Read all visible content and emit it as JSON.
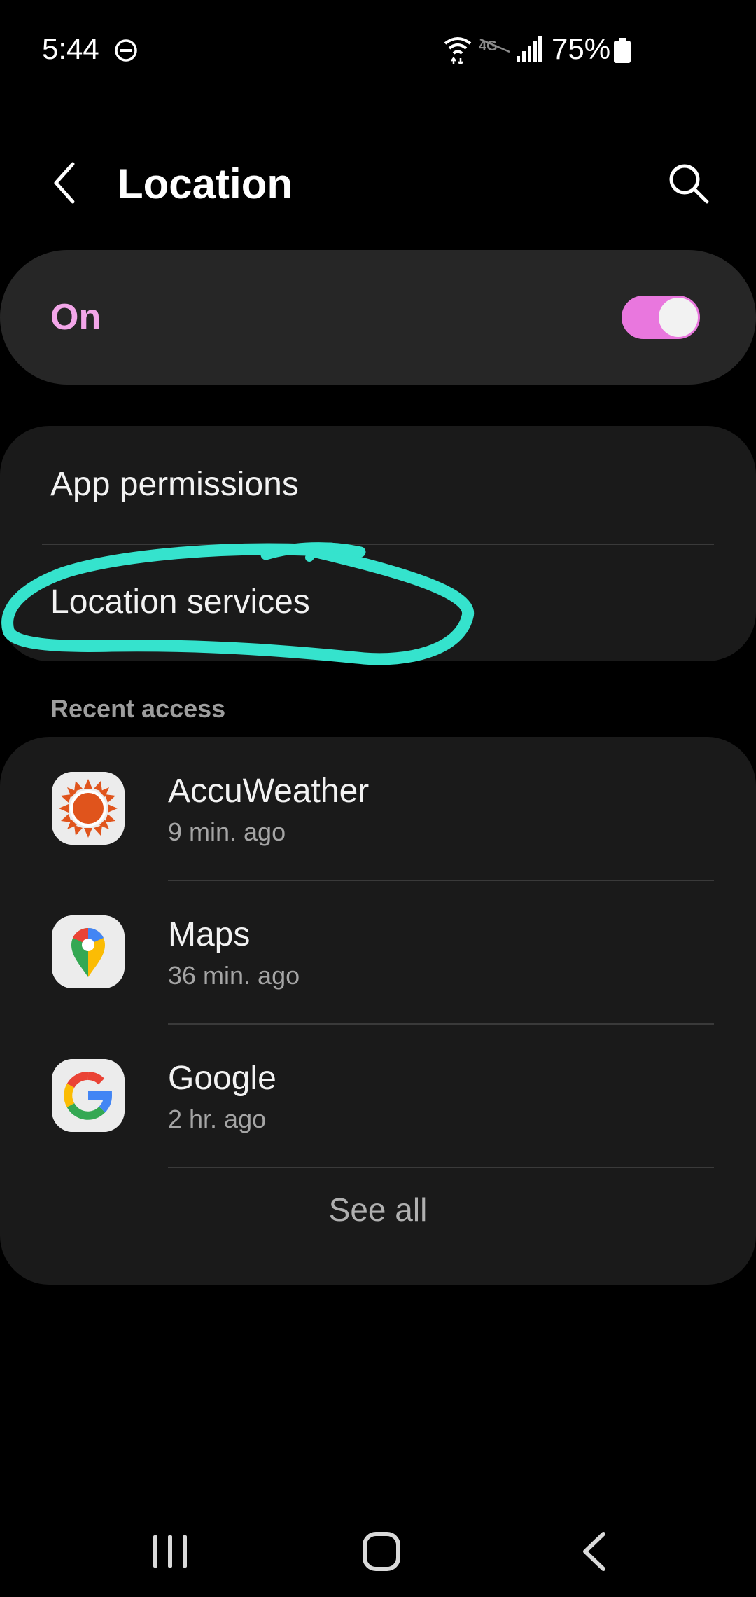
{
  "status_bar": {
    "time": "5:44",
    "battery_percent": "75%",
    "icons": [
      "do-not-disturb-icon",
      "wifi-icon",
      "4g-icon",
      "signal-icon",
      "battery-icon"
    ]
  },
  "header": {
    "title": "Location",
    "back_icon": "chevron-left-icon",
    "search_icon": "search-icon"
  },
  "master_toggle": {
    "label": "On",
    "checked": true,
    "accent_color": "#e977de",
    "label_color": "#f3a6e9"
  },
  "options": [
    {
      "label": "App permissions"
    },
    {
      "label": "Location services",
      "annotated": true,
      "annotation_color": "#35e3cd"
    }
  ],
  "recent_access": {
    "header": "Recent access",
    "apps": [
      {
        "name": "AccuWeather",
        "time": "9 min. ago",
        "icon": "accuweather-icon"
      },
      {
        "name": "Maps",
        "time": "36 min. ago",
        "icon": "google-maps-icon"
      },
      {
        "name": "Google",
        "time": "2 hr. ago",
        "icon": "google-icon"
      }
    ],
    "see_all": "See all"
  },
  "nav_bar": {
    "buttons": [
      "recents-icon",
      "home-icon",
      "back-icon"
    ]
  }
}
